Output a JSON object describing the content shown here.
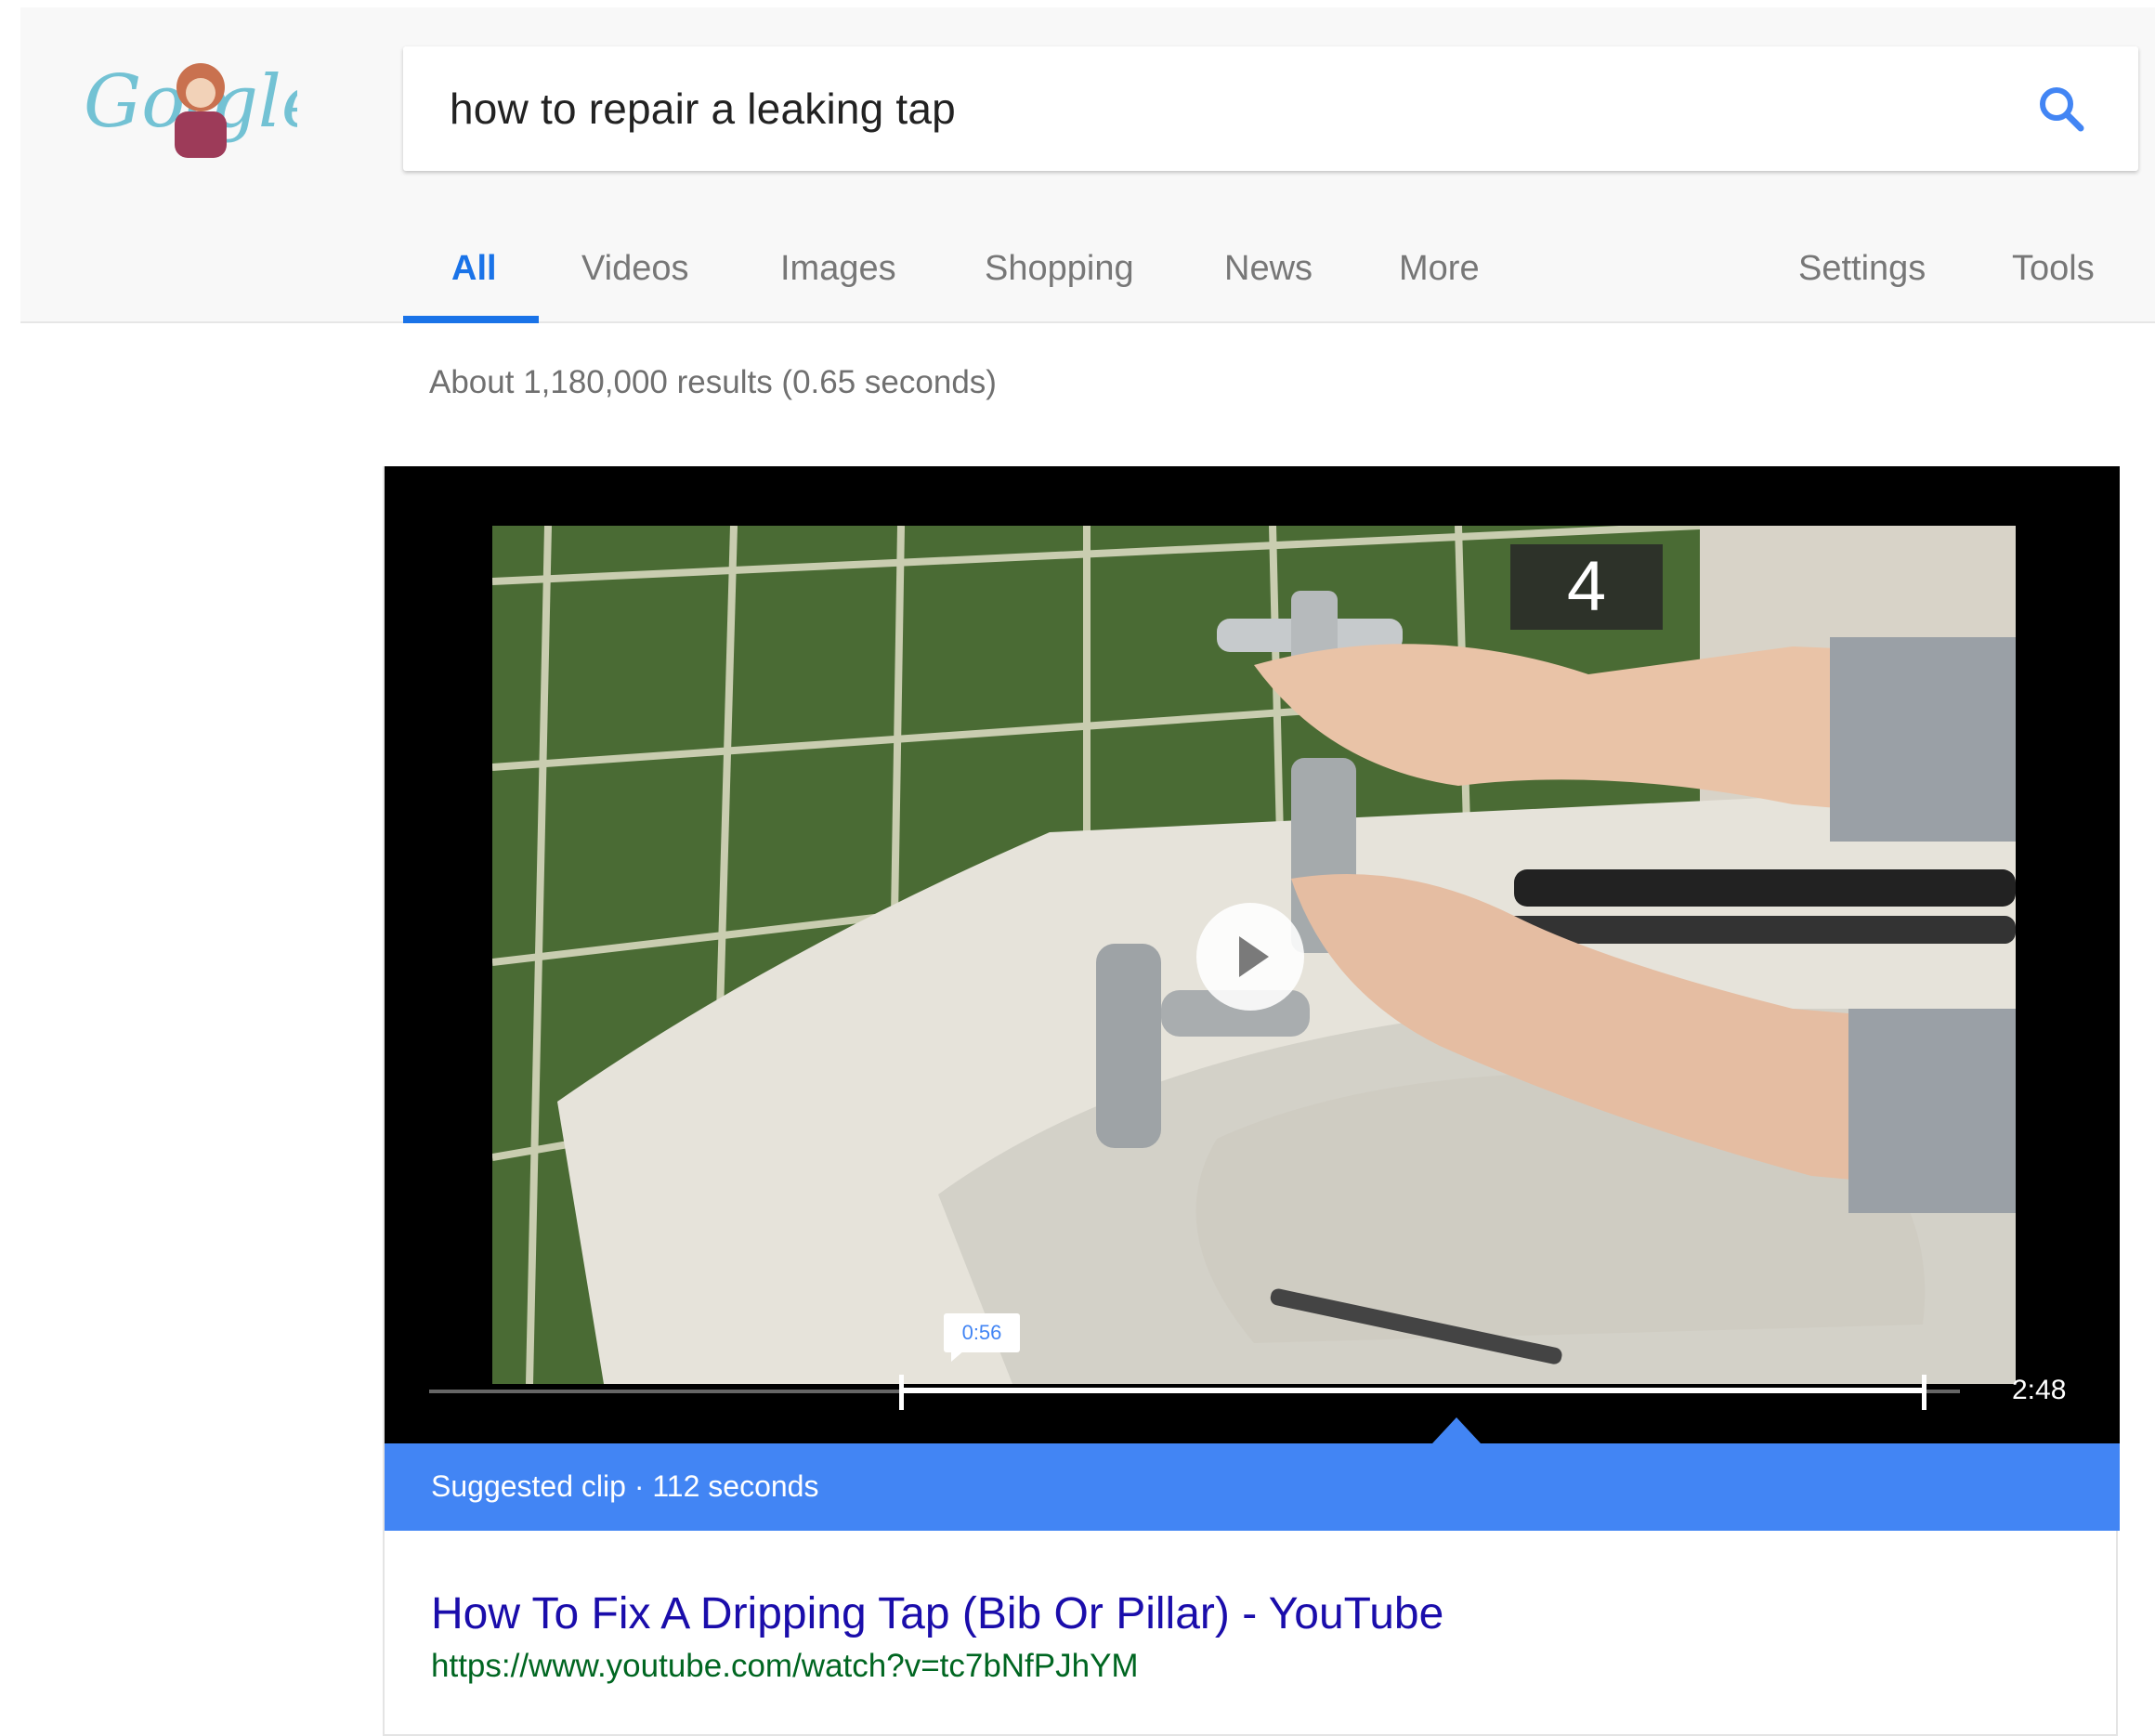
{
  "header": {
    "logo_alt": "Google Doodle",
    "search": {
      "value": "how to repair a leaking tap"
    }
  },
  "tabs": [
    {
      "label": "All",
      "active": true
    },
    {
      "label": "Videos"
    },
    {
      "label": "Images"
    },
    {
      "label": "Shopping"
    },
    {
      "label": "News"
    },
    {
      "label": "More"
    },
    {
      "label": "Settings"
    },
    {
      "label": "Tools"
    }
  ],
  "result_stats": "About 1,180,000 results (0.65 seconds)",
  "featured_video": {
    "step_number": "4",
    "clip_start": "0:56",
    "duration": "2:48",
    "suggested_clip_label": "Suggested clip · 112 seconds",
    "result": {
      "title": "How To Fix A Dripping Tap (Bib Or Pillar) - YouTube",
      "url": "https://www.youtube.com/watch?v=tc7bNfPJhYM"
    }
  },
  "colors": {
    "accent": "#1a73e8",
    "clip_bar": "#4285f4",
    "link": "#1a0dab",
    "url": "#006621"
  }
}
